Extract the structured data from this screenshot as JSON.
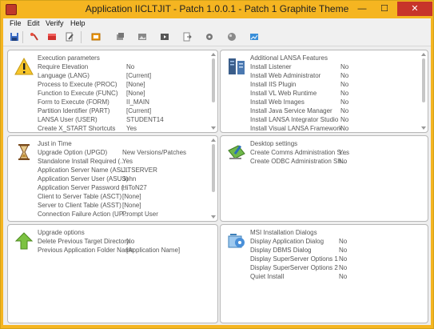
{
  "window": {
    "title": "Application IICLTJIT - Patch 1.0.0.1 - Patch 1 Graphite Theme",
    "minimize": "—",
    "maximize": "☐",
    "close": "✕"
  },
  "menu": [
    {
      "label": "File"
    },
    {
      "label": "Edit"
    },
    {
      "label": "Verify"
    },
    {
      "label": "Help"
    }
  ],
  "toolbar": {
    "icons": [
      "save-icon",
      "wand-icon",
      "cube-red-icon",
      "edit-page-icon",
      "window-orange-icon",
      "stack-icon",
      "image-icon",
      "video-icon",
      "export-page-icon",
      "gear-icon",
      "sphere-icon",
      "chart-window-icon"
    ]
  },
  "panels": {
    "execution": {
      "title": "Execution parameters",
      "rows": [
        {
          "label": "Require Elevation",
          "value": "No"
        },
        {
          "label": "Language (LANG)",
          "value": "[Current]"
        },
        {
          "label": "Process to Execute (PROC)",
          "value": "[None]"
        },
        {
          "label": "Function to Execute (FUNC)",
          "value": "[None]"
        },
        {
          "label": "Form to Execute (FORM)",
          "value": "II_MAIN"
        },
        {
          "label": "Partition Identifier (PART)",
          "value": "[Current]"
        },
        {
          "label": "LANSA User (USER)",
          "value": "STUDENT14"
        },
        {
          "label": "Create X_START Shortcuts",
          "value": "Yes"
        }
      ]
    },
    "lansa": {
      "title": "Additional LANSA Features",
      "rows": [
        {
          "label": "Install Listener",
          "value": "No"
        },
        {
          "label": "Install Web Administrator",
          "value": "No"
        },
        {
          "label": "Install IIS Plugin",
          "value": "No"
        },
        {
          "label": "Install VL Web Runtime",
          "value": "No"
        },
        {
          "label": "Install Web Images",
          "value": "No"
        },
        {
          "label": "Install Java Service Manager",
          "value": "No"
        },
        {
          "label": "Install LANSA Integrator Studio",
          "value": "No"
        },
        {
          "label": "Install Visual LANSA Framework",
          "value": "No"
        }
      ]
    },
    "jit": {
      "title": "Just in Time",
      "rows": [
        {
          "label": "Upgrade Option (UPGD)",
          "value": "New Versions/Patches"
        },
        {
          "label": "Standalone Install Required (...",
          "value": "Yes"
        },
        {
          "label": "Application Server Name (ASL...",
          "value": "JITSERVER"
        },
        {
          "label": "Application Server User (ASUS)",
          "value": "John"
        },
        {
          "label": "Application Server Password (...",
          "value": "HiToN27"
        },
        {
          "label": "Client to Server Table (ASCT)",
          "value": "[None]"
        },
        {
          "label": "Server to Client Table (ASST)",
          "value": "[None]"
        },
        {
          "label": "Connection Failure Action (UP...",
          "value": "Prompt User"
        }
      ]
    },
    "desktop": {
      "title": "Desktop settings",
      "rows": [
        {
          "label": "Create Comms Administration S...",
          "value": "Yes"
        },
        {
          "label": "Create ODBC Administration Sh...",
          "value": "No"
        }
      ]
    },
    "upgrade": {
      "title": "Upgrade options",
      "rows": [
        {
          "label": "Delete Previous Target Directory",
          "value": "No"
        },
        {
          "label": "Previous Application Folder Name",
          "value": "[Application Name]"
        }
      ]
    },
    "msi": {
      "title": "MSI Installation Dialogs",
      "rows": [
        {
          "label": "Display Application Dialog",
          "value": "No"
        },
        {
          "label": "Display DBMS Dialog",
          "value": "No"
        },
        {
          "label": "Display SuperServer Options 1",
          "value": "No"
        },
        {
          "label": "Display SuperServer Options 2",
          "value": "No"
        },
        {
          "label": "Quiet Install",
          "value": "No"
        }
      ]
    }
  }
}
